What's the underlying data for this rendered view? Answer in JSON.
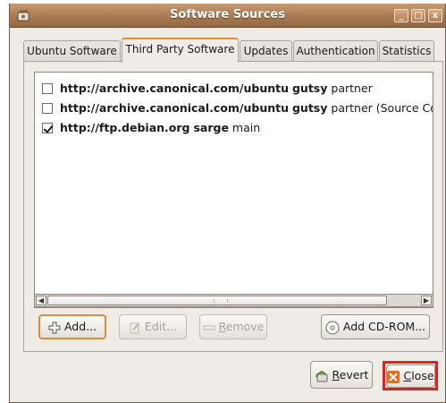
{
  "window": {
    "title": "Software Sources",
    "controls": {
      "minimize": "_",
      "maximize": "□",
      "close": "x"
    }
  },
  "tabs": [
    {
      "label": "Ubuntu Software",
      "active": false
    },
    {
      "label": "Third Party Software",
      "active": true
    },
    {
      "label": "Updates",
      "active": false
    },
    {
      "label": "Authentication",
      "active": false
    },
    {
      "label": "Statistics",
      "active": false
    }
  ],
  "sources": [
    {
      "checked": false,
      "url": "http://archive.canonical.com/ubuntu",
      "dist": "gutsy",
      "component": "partner"
    },
    {
      "checked": false,
      "url": "http://archive.canonical.com/ubuntu",
      "dist": "gutsy",
      "component": "partner (Source Co"
    },
    {
      "checked": true,
      "url": "http://ftp.debian.org",
      "dist": "sarge",
      "component": "main"
    }
  ],
  "buttons": {
    "add": "Add...",
    "edit": "Edit...",
    "remove_pre": "",
    "remove_mnemonic": "R",
    "remove_post": "emove",
    "add_cdrom": "Add CD-ROM...",
    "revert_mnemonic": "R",
    "revert_post": "evert",
    "close_mnemonic": "C",
    "close_post": "lose"
  },
  "colors": {
    "accent": "#e08c3a",
    "titlebar": "#a97a52",
    "highlight": "#e3201b"
  }
}
